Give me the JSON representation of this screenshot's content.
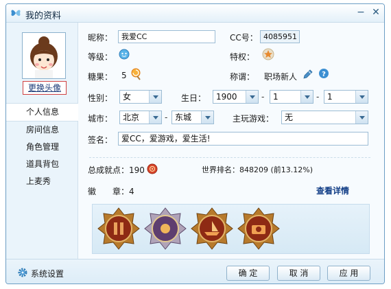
{
  "window": {
    "title": "我的资料"
  },
  "left": {
    "change_avatar": "更换头像",
    "nav": [
      "个人信息",
      "房间信息",
      "角色管理",
      "道具背包",
      "上麦秀"
    ]
  },
  "profile": {
    "nickname_label": "昵称：",
    "nickname": "我爱CC",
    "cc_label": "CC号：",
    "cc": "4085951",
    "level_label": "等级：",
    "privilege_label": "特权：",
    "candy_label": "糖果：",
    "candy": "5",
    "title_label": "称谓：",
    "title": "职场新人",
    "gender_label": "性别：",
    "gender": "女",
    "birthday_label": "生日：",
    "birth_year": "1900",
    "birth_month": "1",
    "birth_day": "1",
    "dash": "-",
    "city_label": "城市：",
    "city": "北京",
    "district": "东城",
    "game_label": "主玩游戏：",
    "game": "无",
    "signature_label": "签名：",
    "signature": "爱CC，爱游戏，爱生活!"
  },
  "stats": {
    "achievement_label": "总成就点：190",
    "world_rank_label": "世界排名：848209 (前13.12%)",
    "medal_label": "徽　　章：4",
    "view_detail": "查看详情"
  },
  "footer": {
    "settings": "系统设置",
    "ok": "确 定",
    "cancel": "取 消",
    "apply": "应 用"
  },
  "colors": {
    "accent": "#6b9dc4",
    "link": "#113d86",
    "highlight_border": "#d04040"
  }
}
